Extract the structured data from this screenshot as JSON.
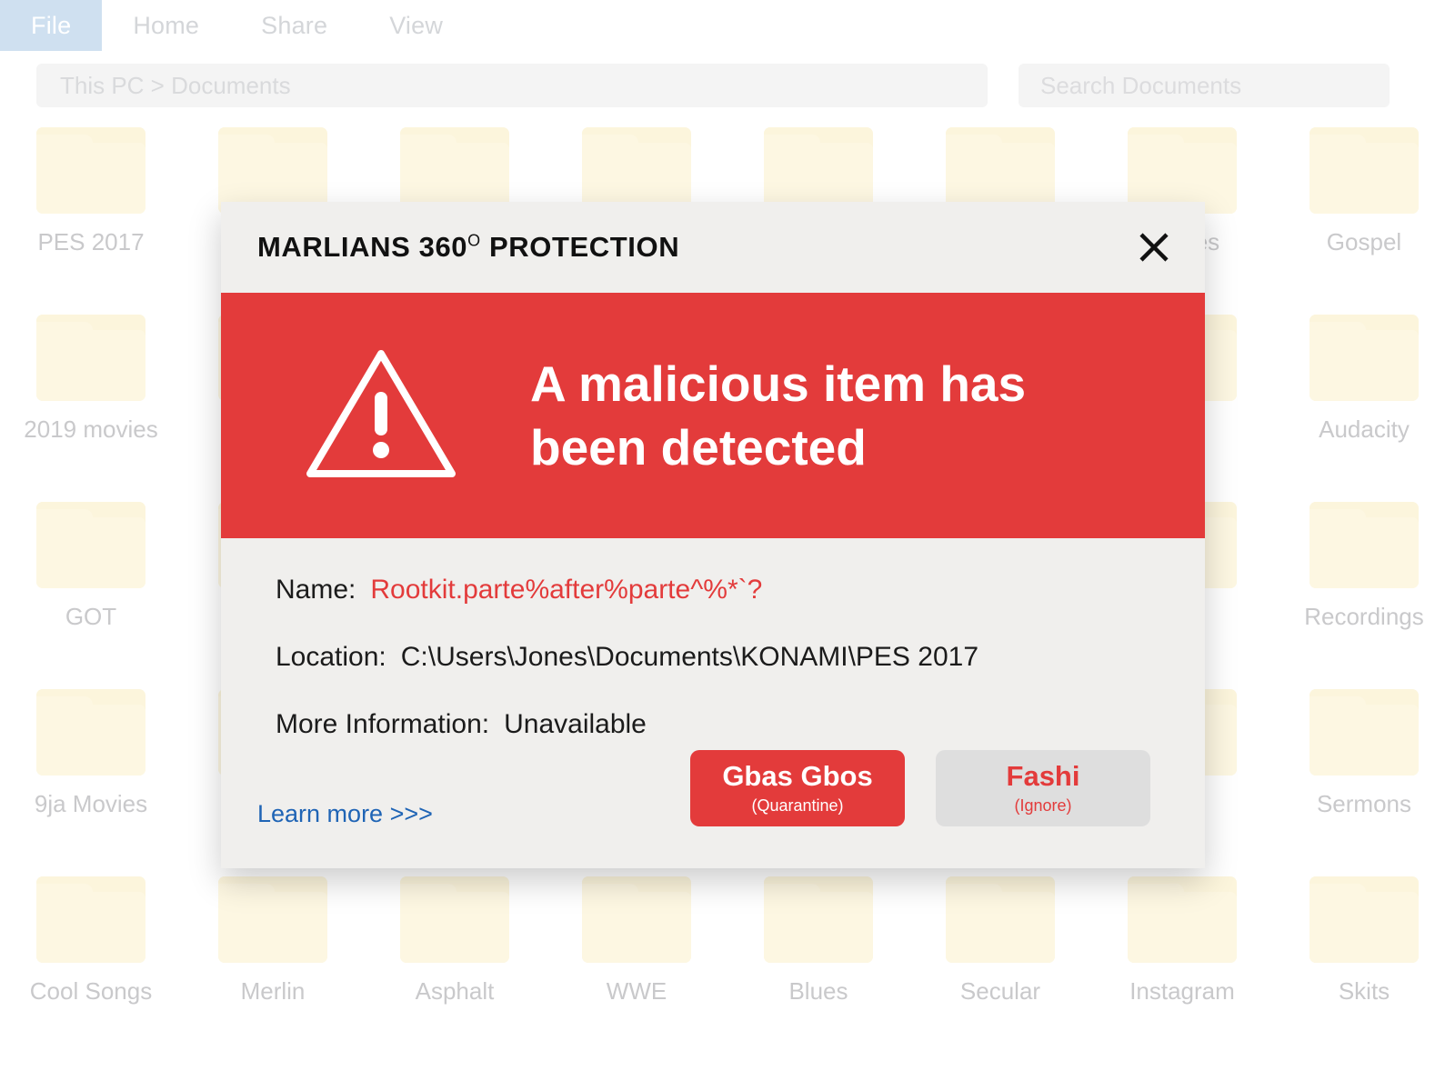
{
  "explorer": {
    "ribbon_tabs": [
      {
        "label": "File",
        "active": true
      },
      {
        "label": "Home",
        "active": false
      },
      {
        "label": "Share",
        "active": false
      },
      {
        "label": "View",
        "active": false
      }
    ],
    "breadcrumb": "This PC > Documents",
    "search_placeholder": "Search Documents",
    "folders": [
      "PES 2017",
      "",
      "",
      "",
      "",
      "",
      "Movies",
      "Gospel",
      "2019 movies",
      "",
      "",
      "",
      "",
      "",
      "",
      "Audacity",
      "GOT",
      "",
      "",
      "",
      "",
      "",
      "",
      "Recordings",
      "9ja Movies",
      "",
      "",
      "",
      "",
      "",
      "",
      "Sermons",
      "Cool Songs",
      "Merlin",
      "Asphalt",
      "WWE",
      "Blues",
      "Secular",
      "Instagram",
      "Skits"
    ]
  },
  "dialog": {
    "title_main": "MARLIANS 360",
    "title_degree": "O",
    "title_suffix": " PROTECTION",
    "close_icon": "close-icon",
    "warning_icon": "warning-triangle-icon",
    "headline": "A malicious item has been detected",
    "details": [
      {
        "label": "Name:",
        "value": "Rootkit.parte%after%parte^%*`?",
        "threat": true
      },
      {
        "label": "Location:",
        "value": "C:\\Users\\Jones\\Documents\\KONAMI\\PES 2017",
        "threat": false
      },
      {
        "label": "More Information:",
        "value": "Unavailable",
        "threat": false
      }
    ],
    "learn_more": "Learn more >>>",
    "buttons": {
      "quarantine": {
        "main": "Gbas Gbos",
        "sub": "(Quarantine)"
      },
      "ignore": {
        "main": "Fashi",
        "sub": "(Ignore)"
      }
    }
  },
  "colors": {
    "alert_red": "#E33B3B",
    "dialog_bg": "#F0EFED",
    "link_blue": "#1F64B5",
    "folder_cream": "#FDF7E2",
    "tab_active_blue": "#CFE0F0"
  }
}
